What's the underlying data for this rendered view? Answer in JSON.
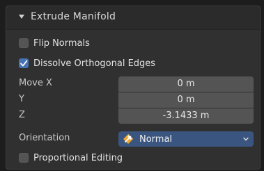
{
  "panel": {
    "title": "Extrude Manifold",
    "expanded": true,
    "expand_icon": "triangle-down-icon"
  },
  "options": {
    "flip_normals": {
      "label": "Flip Normals",
      "checked": false
    },
    "dissolve_orthogonal_edges": {
      "label": "Dissolve Orthogonal Edges",
      "checked": true
    },
    "proportional_editing": {
      "label": "Proportional Editing",
      "checked": false
    }
  },
  "move": {
    "x": {
      "label": "Move X",
      "value": "0 m"
    },
    "y": {
      "label": "Y",
      "value": "0 m"
    },
    "z": {
      "label": "Z",
      "value": "-3.1433 m"
    }
  },
  "orientation": {
    "label": "Orientation",
    "value": "Normal",
    "icon": "orientation-normal-icon"
  },
  "colors": {
    "accent": "#4772b3",
    "dropdown_bg": "#3a5680",
    "field_bg": "#545454",
    "panel_bg": "#303030"
  }
}
